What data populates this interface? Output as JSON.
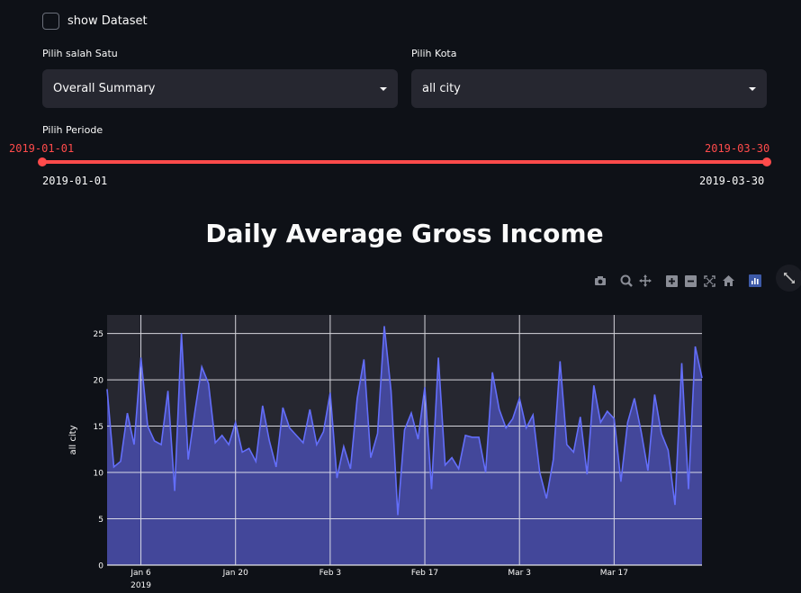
{
  "controls": {
    "show_dataset_label": "show Dataset",
    "select1": {
      "label": "Pilih salah Satu",
      "value": "Overall Summary"
    },
    "select2": {
      "label": "Pilih Kota",
      "value": "all city"
    },
    "slider": {
      "label": "Pilih Periode",
      "min": "2019-01-01",
      "max": "2019-03-30",
      "value_start": "2019-01-01",
      "value_end": "2019-03-30"
    }
  },
  "colors": {
    "accent": "#ff4b4b",
    "line": "#636efa",
    "fill": "#4449a0",
    "plot_bg": "#262730"
  },
  "modebar_icons": [
    "camera-icon",
    "zoom-icon",
    "pan-icon",
    "zoom-in-icon",
    "zoom-out-icon",
    "autoscale-icon",
    "reset-axes-icon",
    "plotly-logo-icon"
  ],
  "chart_data": {
    "type": "area",
    "title": "Daily Average Gross Income",
    "ylabel": "all city",
    "xlabel": "",
    "ylim": [
      0,
      27
    ],
    "yticks": [
      0,
      5,
      10,
      15,
      20,
      25
    ],
    "xtick_labels": [
      "Jan 6",
      "Jan 20",
      "Feb 3",
      "Feb 17",
      "Mar 3",
      "Mar 17"
    ],
    "xtick_sublabel": "2019",
    "x_start": "2019-01-01",
    "x_end": "2019-03-30",
    "grid": true,
    "values": [
      19,
      10.6,
      11.2,
      16.4,
      13,
      22.4,
      15,
      13.4,
      13,
      18.8,
      8,
      25,
      11.4,
      16.6,
      21.4,
      19.6,
      13.2,
      14,
      13,
      15.4,
      12.2,
      12.6,
      11.2,
      17.2,
      13.4,
      10.6,
      17,
      14.8,
      14,
      13.2,
      16.8,
      13,
      14.4,
      18.6,
      9.4,
      12.8,
      10.4,
      18,
      22.2,
      11.6,
      14.2,
      25.8,
      18.8,
      5.4,
      14.6,
      16.4,
      13.6,
      19.2,
      8.2,
      22.4,
      10.8,
      11.6,
      10.4,
      14,
      13.8,
      13.8,
      10,
      20.8,
      16.8,
      14.8,
      15.8,
      18,
      14.8,
      16.2,
      10,
      7.2,
      11.4,
      22,
      13,
      12.2,
      16,
      9.8,
      19.4,
      15.4,
      16.6,
      15.8,
      9,
      15.4,
      18,
      14.4,
      10.2,
      18.4,
      14.2,
      12.4,
      6.5,
      21.8,
      8.2,
      23.6,
      20.2
    ]
  }
}
